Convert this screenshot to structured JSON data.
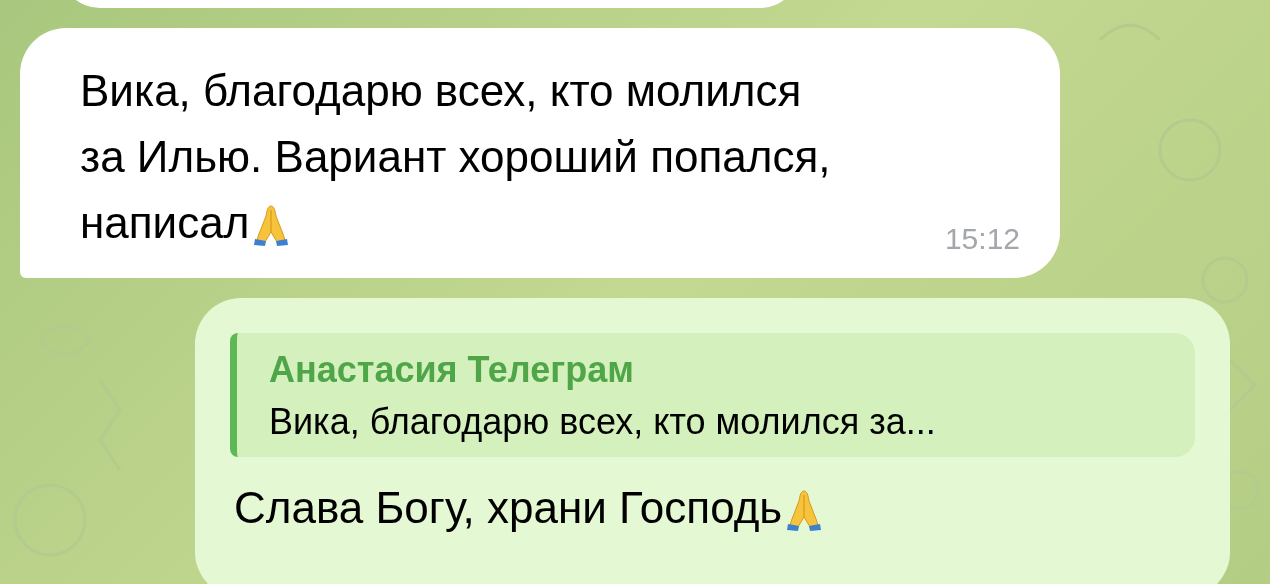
{
  "messages": [
    {
      "kind": "partial"
    },
    {
      "kind": "incoming",
      "lines": [
        "Вика, благодарю всех, кто молился",
        "за Илью. Вариант хороший попался,",
        "написал"
      ],
      "praying_hands": true,
      "time": "15:12"
    },
    {
      "kind": "outgoing",
      "reply": {
        "author": "Анастасия Телеграм",
        "text": "Вика, благодарю всех, кто молился за..."
      },
      "lines": [
        "Слава Богу, храни Господь"
      ],
      "praying_hands": true
    }
  ]
}
